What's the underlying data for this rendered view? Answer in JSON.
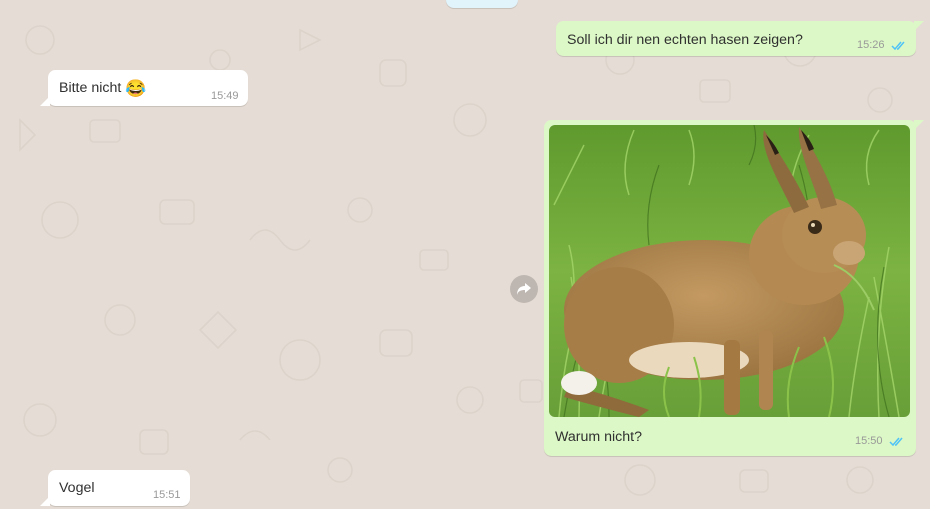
{
  "messages": [
    {
      "direction": "out",
      "text": "Soll ich dir nen echten hasen zeigen?",
      "time": "15:26",
      "status": "read"
    },
    {
      "direction": "in",
      "text": "Bitte nicht",
      "emoji": "😂",
      "time": "15:49"
    },
    {
      "direction": "out",
      "image": "hare-in-grass",
      "caption": "Warum nicht?",
      "time": "15:50",
      "status": "read"
    },
    {
      "direction": "in",
      "text": "Vogel",
      "time": "15:51"
    }
  ],
  "colors": {
    "chat_bg": "#e5ddd5",
    "outgoing": "#dcf8c6",
    "incoming": "#ffffff",
    "read_ticks": "#4fc3f7"
  }
}
